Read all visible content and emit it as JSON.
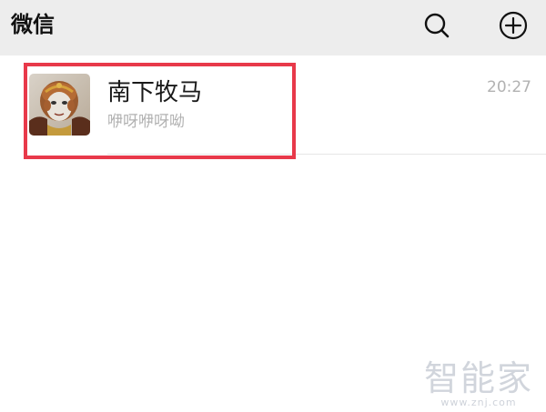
{
  "header": {
    "title": "微信",
    "search_icon": "search-icon",
    "add_icon": "plus-circle-icon"
  },
  "chats": [
    {
      "name": "南下牧马",
      "preview": "咿呀咿呀呦",
      "time": "20:27",
      "avatar": "monkey-king-avatar",
      "highlighted": true
    }
  ],
  "colors": {
    "header_bg": "#ededed",
    "highlight": "#e8394a",
    "secondary_text": "#b2b2b2"
  },
  "watermark": {
    "main": "智能家",
    "url": "www.znj.com"
  }
}
